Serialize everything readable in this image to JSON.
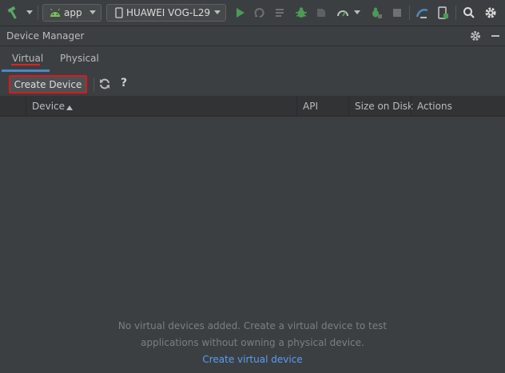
{
  "toolbar": {
    "module_label": "app",
    "device_label": "HUAWEI VOG-L29"
  },
  "panel": {
    "title": "Device Manager"
  },
  "tabs": [
    {
      "label": "Virtual",
      "selected": true
    },
    {
      "label": "Physical",
      "selected": false
    }
  ],
  "actions": {
    "create_device_label": "Create Device",
    "help_label": "?"
  },
  "table": {
    "columns": [
      "Device",
      "API",
      "Size on Disk",
      "Actions"
    ],
    "sort_column": "Device",
    "sort_direction": "ascending"
  },
  "empty_state": {
    "line1": "No virtual devices added. Create a virtual device to test",
    "line2": "applications without owning a physical device.",
    "link": "Create virtual device"
  },
  "colors": {
    "accent": "#4a88c7",
    "highlight": "#d81b1b",
    "run_green": "#499c54",
    "link": "#589df6"
  }
}
